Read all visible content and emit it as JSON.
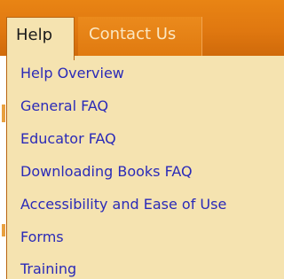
{
  "tabs": {
    "active": "Help",
    "other": "Contact Us"
  },
  "menu": {
    "items": [
      "Help Overview",
      "General FAQ",
      "Educator FAQ",
      "Downloading Books FAQ",
      "Accessibility and Ease of Use",
      "Forms",
      "Training"
    ]
  },
  "colors": {
    "tabbar": "#e07810",
    "menu_background": "#f5e3b0",
    "link": "#2a2ab8"
  }
}
